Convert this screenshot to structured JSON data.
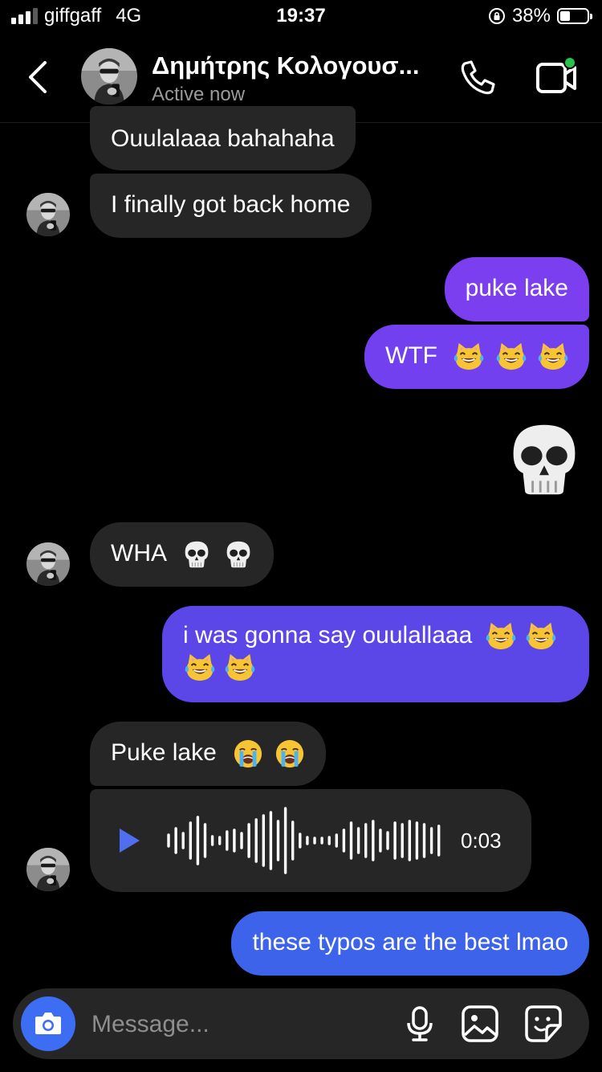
{
  "status_bar": {
    "carrier": "giffgaff",
    "network": "4G",
    "time": "19:37",
    "battery_percent_label": "38%",
    "battery_level": 0.38
  },
  "header": {
    "contact_name": "Δημήτρης Κολογουσ...",
    "presence": "Active now",
    "icons": [
      "back-arrow-icon",
      "phone-icon",
      "video-call-icon"
    ]
  },
  "colors": {
    "background": "#000000",
    "incoming_bubble": "#262626",
    "outgoing_purple": "#7b3ff0",
    "outgoing_indigo": "#5b46e8",
    "outgoing_blue": "#3d63ea",
    "active_dot": "#26c24a",
    "camera_button": "#3d6df2"
  },
  "messages": [
    {
      "side": "in",
      "text": "Ouulalaaa bahahaha"
    },
    {
      "side": "in",
      "text": "I finally got back home"
    },
    {
      "side": "out",
      "text": "puke lake"
    },
    {
      "side": "out",
      "text": "WTF",
      "emojis": [
        "joy-cat",
        "joy-cat",
        "joy-cat"
      ]
    },
    {
      "side": "out",
      "emojis": [
        "skull"
      ]
    },
    {
      "side": "in",
      "text": "WHA",
      "emojis": [
        "skull",
        "skull"
      ]
    },
    {
      "side": "out",
      "text": "i was gonna say ouulallaaa",
      "emojis": [
        "joy-cat",
        "joy-cat",
        "joy-cat",
        "joy-cat"
      ]
    },
    {
      "side": "in",
      "text": "Puke lake",
      "emojis": [
        "loudly-crying",
        "loudly-crying"
      ]
    },
    {
      "side": "in",
      "type": "voice",
      "duration": "0:03"
    },
    {
      "side": "out",
      "text": "these typos are the best lmao"
    }
  ],
  "composer": {
    "placeholder": "Message...",
    "icons": [
      "camera-icon",
      "microphone-icon",
      "gallery-icon",
      "sticker-icon"
    ]
  }
}
